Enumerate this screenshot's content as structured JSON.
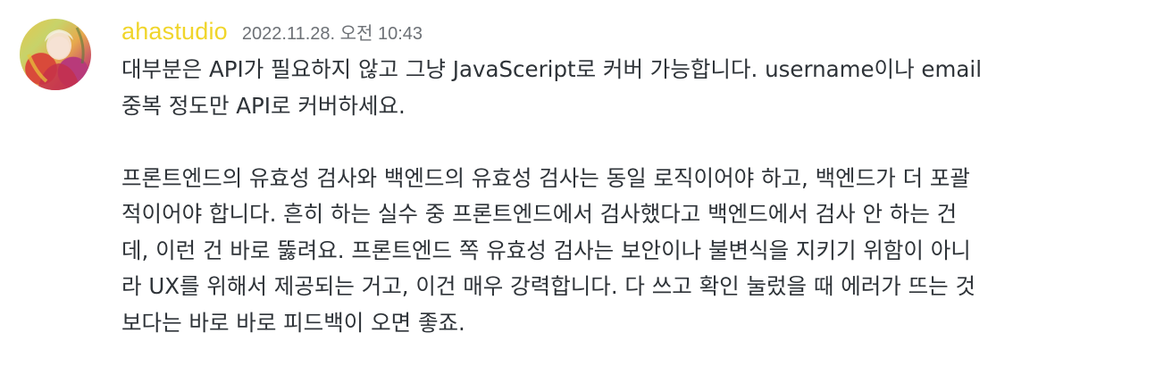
{
  "message": {
    "author": "ahastudio",
    "timestamp": "2022.11.28. 오전 10:43",
    "paragraphs": [
      {
        "lines": [
          "대부분은 API가 필요하지 않고 그냥 JavaSceript로 커버 가능합니다. username이나 email",
          "중복 정도만 API로 커버하세요."
        ]
      },
      {
        "lines": [
          "프론트엔드의 유효성 검사와 백엔드의 유효성 검사는 동일 로직이어야 하고, 백엔드가 더 포괄",
          "적이어야 합니다. 흔히 하는 실수 중 프론트엔드에서 검사했다고 백엔드에서 검사 안 하는 건",
          "데, 이런 건 바로 뚫려요. 프론트엔드 쪽 유효성 검사는 보안이나 불변식을 지키기 위함이 아니",
          "라 UX를 위해서 제공되는 거고, 이건 매우 강력합니다. 다 쓰고 확인 눌렀을 때 에러가 뜨는 것",
          "보다는 바로 바로 피드백이 오면 좋죠."
        ]
      }
    ]
  },
  "colors": {
    "author": "#f0d52a",
    "timestamp": "#6d7176",
    "text": "#2e3338",
    "background": "#ffffff"
  },
  "icons": {
    "avatar": "user-avatar-image"
  }
}
